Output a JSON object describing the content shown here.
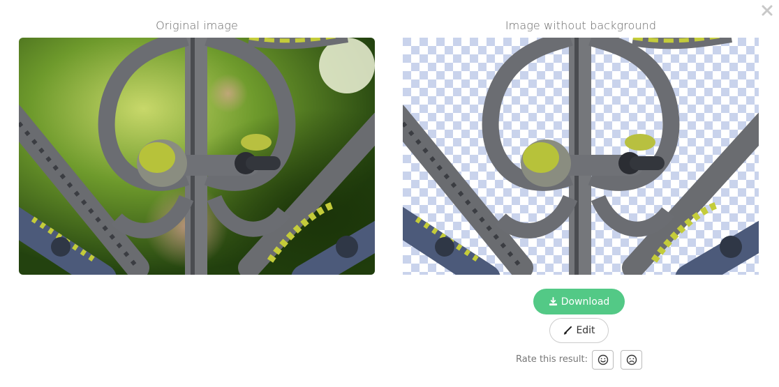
{
  "panels": {
    "original_title": "Original image",
    "result_title": "Image without background"
  },
  "actions": {
    "download_label": "Download",
    "edit_label": "Edit"
  },
  "rating": {
    "label": "Rate this result:"
  },
  "colors": {
    "accent": "#53c986",
    "checker": "#c9d3ec"
  },
  "icons": {
    "close": "close-icon",
    "download": "download-icon",
    "edit": "paintbrush-icon",
    "good": "smile-icon",
    "bad": "frown-icon"
  }
}
